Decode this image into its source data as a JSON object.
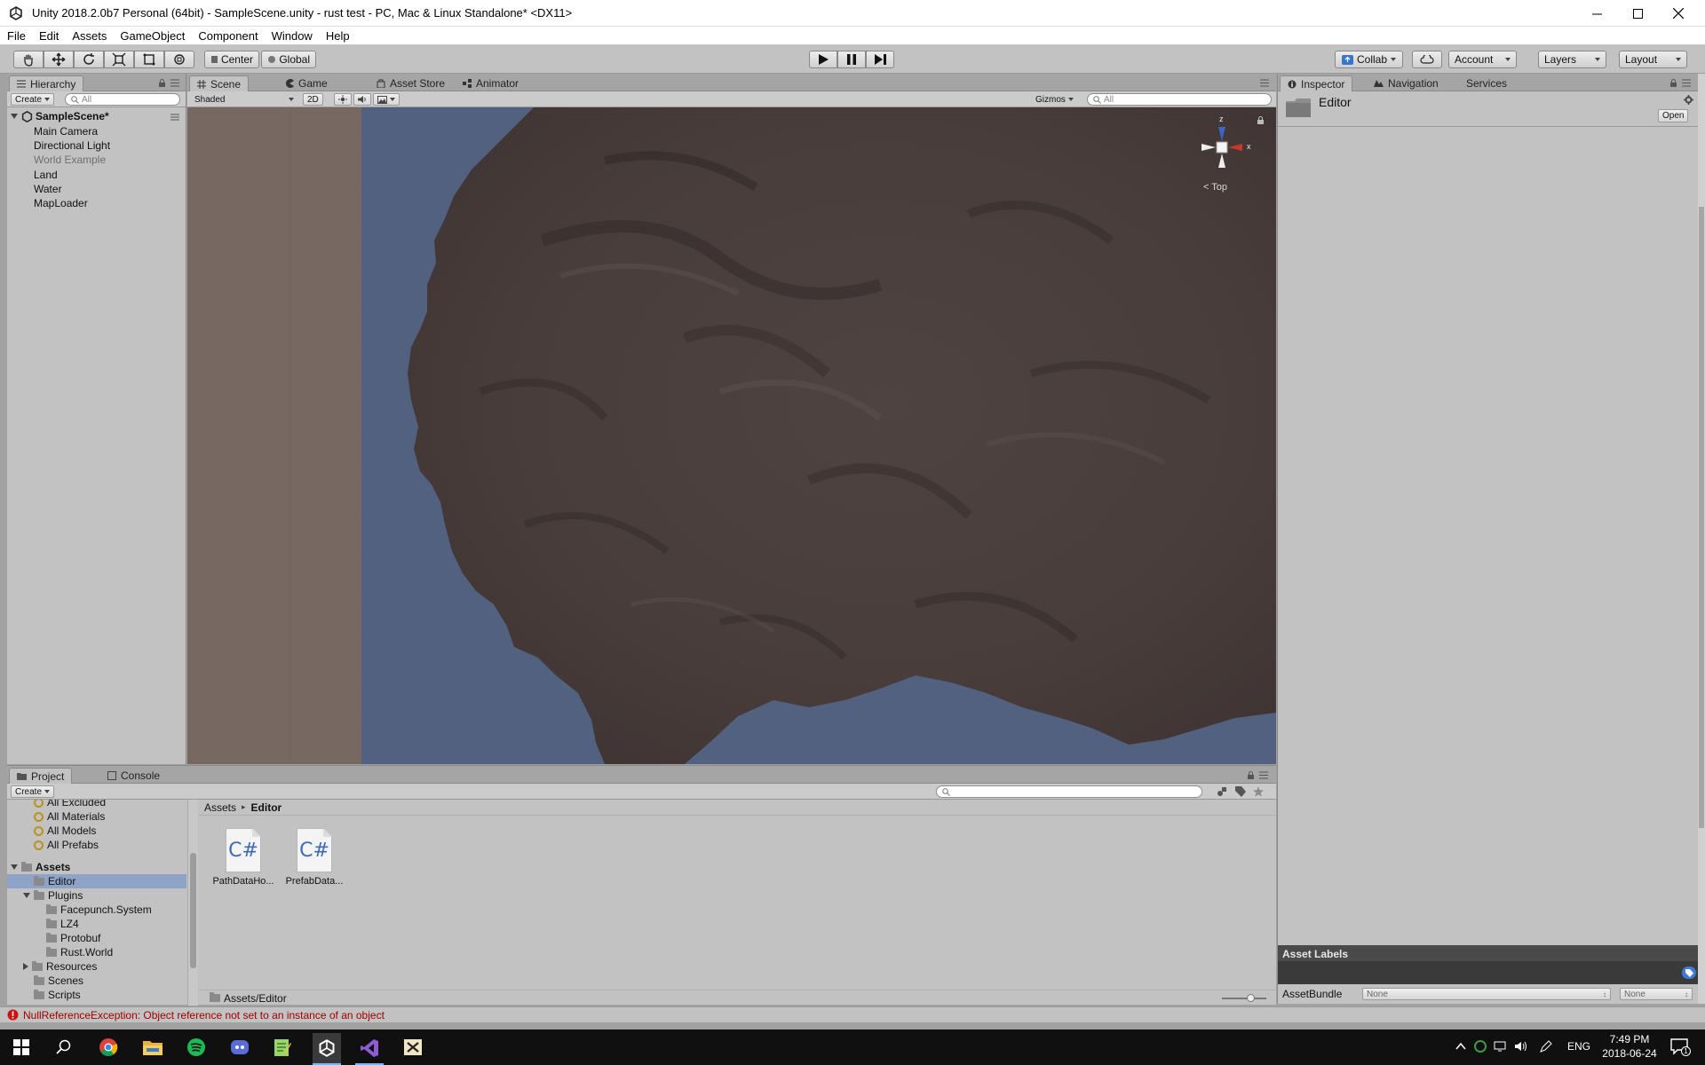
{
  "window": {
    "title": "Unity 2018.2.0b7 Personal (64bit) - SampleScene.unity - rust test - PC, Mac & Linux Standalone* <DX11>"
  },
  "menu": [
    "File",
    "Edit",
    "Assets",
    "GameObject",
    "Component",
    "Window",
    "Help"
  ],
  "toolbar": {
    "pivot": "Center",
    "space": "Global",
    "collab": "Collab",
    "account": "Account",
    "layers": "Layers",
    "layout": "Layout"
  },
  "hierarchy": {
    "tab": "Hierarchy",
    "create": "Create",
    "search_placeholder": "All",
    "scene": "SampleScene*",
    "items": [
      "Main Camera",
      "Directional Light",
      "World Example",
      "Land",
      "Water",
      "MapLoader"
    ]
  },
  "scene_view": {
    "tabs": [
      "Scene",
      "Game",
      "Asset Store",
      "Animator"
    ],
    "shading": "Shaded",
    "mode_2d": "2D",
    "gizmos": "Gizmos",
    "search_placeholder": "All",
    "gizmo_label": "Top",
    "axis_z": "z",
    "axis_x": "x"
  },
  "inspector": {
    "tabs": [
      "Inspector",
      "Navigation",
      "Services"
    ],
    "object_name": "Editor",
    "open_button": "Open",
    "asset_labels": "Asset Labels",
    "asset_bundle_label": "AssetBundle",
    "asset_bundle_value": "None",
    "asset_variant_value": "None"
  },
  "project": {
    "tabs": [
      "Project",
      "Console"
    ],
    "create": "Create",
    "favorites": [
      "All Excluded",
      "All Materials",
      "All Models",
      "All Prefabs"
    ],
    "assets_root": "Assets",
    "tree": {
      "editor": "Editor",
      "plugins": "Plugins",
      "plugin_children": [
        "Facepunch.System",
        "LZ4",
        "Protobuf",
        "Rust.World"
      ],
      "resources": "Resources",
      "scenes": "Scenes",
      "scripts": "Scripts"
    },
    "breadcrumb": [
      "Assets",
      "Editor"
    ],
    "files": [
      {
        "name": "PathDataHo...",
        "icon": "C#"
      },
      {
        "name": "PrefabData...",
        "icon": "C#"
      }
    ],
    "footer_path": "Assets/Editor"
  },
  "status": {
    "message": "NullReferenceException: Object reference not set to an instance of an object"
  },
  "taskbar": {
    "language": "ENG",
    "time": "7:49 PM",
    "date": "2018-06-24",
    "notification_count": "1",
    "apps": [
      "file-explorer-icon",
      "chrome-icon",
      "explorer-icon",
      "spotify-icon",
      "discord-icon",
      "notepad-icon",
      "unity-icon",
      "visual-studio-icon",
      "xbox-icon"
    ]
  },
  "colors": {
    "water": "#536180",
    "terrain": "#4c4040",
    "panel": "#c2c2c2",
    "error": "#a00000"
  }
}
